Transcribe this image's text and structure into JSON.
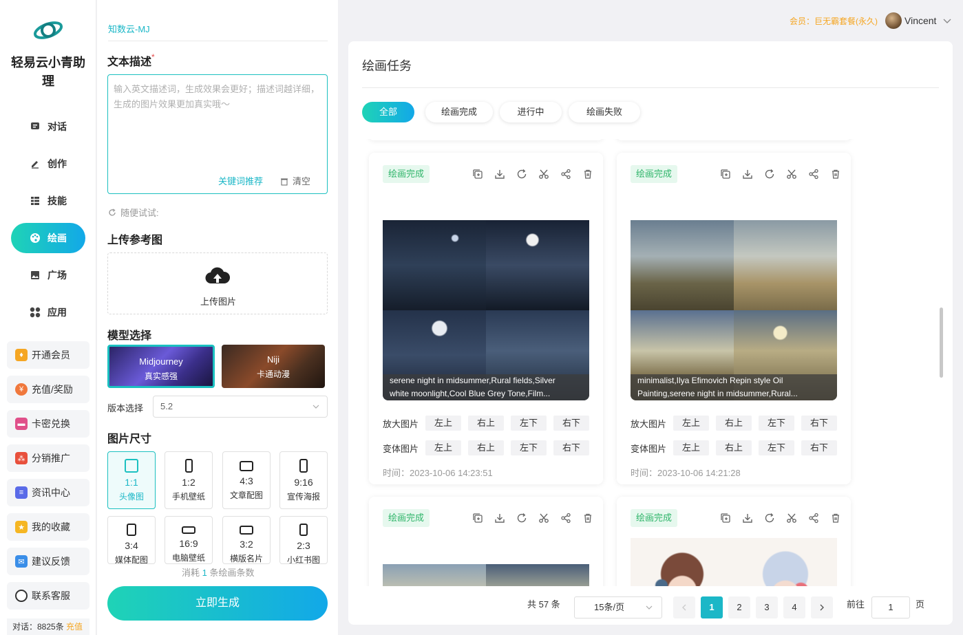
{
  "brand": {
    "name": "轻易云小青助理"
  },
  "nav": [
    {
      "label": "对话",
      "icon": "chat-icon"
    },
    {
      "label": "创作",
      "icon": "pen-icon"
    },
    {
      "label": "技能",
      "icon": "list-icon"
    },
    {
      "label": "绘画",
      "icon": "palette-icon"
    },
    {
      "label": "广场",
      "icon": "image-icon"
    },
    {
      "label": "应用",
      "icon": "grid-icon"
    }
  ],
  "side_buttons": [
    {
      "label": "开通会员",
      "icon": "vip-icon",
      "color": "#f5a623"
    },
    {
      "label": "充值/奖励",
      "icon": "coin-icon",
      "color": "#f0783c"
    },
    {
      "label": "卡密兑换",
      "icon": "card-icon",
      "color": "#e0508a"
    },
    {
      "label": "分销推广",
      "icon": "network-icon",
      "color": "#e8503c"
    },
    {
      "label": "资讯中心",
      "icon": "news-icon",
      "color": "#5a6be8"
    },
    {
      "label": "我的收藏",
      "icon": "star-icon",
      "color": "#f5b623"
    },
    {
      "label": "建议反馈",
      "icon": "mail-icon",
      "color": "#3a8ee8"
    },
    {
      "label": "联系客服",
      "icon": "headset-icon",
      "color": "#333333"
    }
  ],
  "bottom_stat": {
    "label": "对话：8825条",
    "link": "充值"
  },
  "panel": {
    "tab": "知数云-MJ",
    "prompt_title": "文本描述",
    "prompt_required": "*",
    "prompt_placeholder": "输入英文描述词，生成效果会更好；描述词越详细，生成的图片效果更加真实哦～",
    "keyword_link": "关键词推荐",
    "clear_label": "清空",
    "random_label": "随便试试:",
    "upload_title": "上传参考图",
    "upload_label": "上传图片",
    "model_title": "模型选择",
    "models": [
      {
        "name": "Midjourney",
        "desc": "真实感强"
      },
      {
        "name": "Niji",
        "desc": "卡通动漫"
      }
    ],
    "version_label": "版本选择",
    "version_value": "5.2",
    "size_title": "图片尺寸",
    "sizes": [
      {
        "ratio": "1:1",
        "desc": "头像图"
      },
      {
        "ratio": "1:2",
        "desc": "手机壁纸"
      },
      {
        "ratio": "4:3",
        "desc": "文章配图"
      },
      {
        "ratio": "9:16",
        "desc": "宣传海报"
      },
      {
        "ratio": "3:4",
        "desc": "媒体配图"
      },
      {
        "ratio": "16:9",
        "desc": "电脑壁纸"
      },
      {
        "ratio": "3:2",
        "desc": "横版名片"
      },
      {
        "ratio": "2:3",
        "desc": "小红书图"
      }
    ],
    "consume_pre": "消耗",
    "consume_num": "1",
    "consume_post": "条绘画条数",
    "generate_label": "立即生成"
  },
  "topbar": {
    "member": "会员：巨无霸套餐(永久)",
    "username": "Vincent"
  },
  "main": {
    "title": "绘画任务",
    "filters": [
      "全部",
      "绘画完成",
      "进行中",
      "绘画失败"
    ],
    "cards": [
      {
        "status": "绘画完成",
        "caption1": "serene night in midsummer,Rural fields,Silver",
        "caption2": "white moonlight,Cool Blue Grey Tone,Film...",
        "upscale_label": "放大图片",
        "variation_label": "变体图片",
        "quadrants": [
          "左上",
          "右上",
          "左下",
          "右下"
        ],
        "time": "时间：2023-10-06 14:23:51"
      },
      {
        "status": "绘画完成",
        "caption1": "minimalist,Ilya Efimovich Repin style Oil",
        "caption2": "Painting,serene night in midsummer,Rural...",
        "upscale_label": "放大图片",
        "variation_label": "变体图片",
        "quadrants": [
          "左上",
          "右上",
          "左下",
          "右下"
        ],
        "time": "时间：2023-10-06 14:21:28"
      },
      {
        "status": "绘画完成"
      },
      {
        "status": "绘画完成"
      }
    ],
    "pagination": {
      "total": "共 57 条",
      "page_size": "15条/页",
      "pages": [
        "1",
        "2",
        "3",
        "4"
      ],
      "current": "1",
      "goto_label": "前往",
      "goto_value": "1",
      "page_unit": "页"
    }
  }
}
